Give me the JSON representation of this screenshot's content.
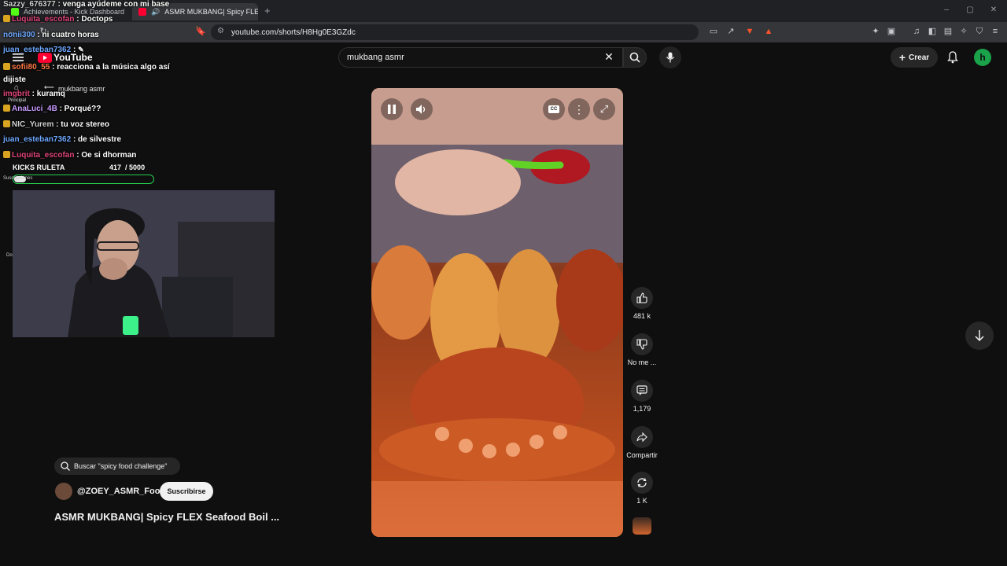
{
  "browser": {
    "tabs": [
      {
        "title": "Achievements - Kick Dashboard"
      },
      {
        "title": "ASMR MUKBANG| Spicy FLEX"
      }
    ],
    "url": "youtube.com/shorts/H8Hg0E3GZdc",
    "new_tab_icon": "plus-icon"
  },
  "youtube": {
    "logo_text": "YouTube",
    "search_query": "mukbang asmr",
    "create_label": "Crear",
    "avatar_letter": "h"
  },
  "chat": [
    {
      "user": "Sazzy_676377",
      "message": ": venga ayúdeme con mi base"
    },
    {
      "user": "Luquita_escofan",
      "message": ": Doctops"
    },
    {
      "user": "nonii300",
      "message": ": ni cuatro horas"
    },
    {
      "user": "juan_esteban7362",
      "message": ":"
    },
    {
      "user": "sofii80_55",
      "message": ": reacciona a la música algo así dijiste"
    },
    {
      "user": "imgbrit",
      "message": ": kuramq"
    },
    {
      "user": "AnaLuci_4B",
      "message": ": Porqué??"
    },
    {
      "user": "NIC_Yurem",
      "message": ": tu voz stereo"
    },
    {
      "user": "juan_esteban7362",
      "message": ": de silvestre"
    },
    {
      "user": "Luquita_escofan",
      "message": ": Oe si dhorman"
    }
  ],
  "overlay": {
    "ghost_search": "mukbang asmr",
    "ghost_home": "Principal",
    "roulette_label": "KICKS RULETA",
    "roulette_count": "417",
    "roulette_goal": "/ 5000",
    "roulette_progress": 0.083,
    "subs_label": "Suscripciones",
    "side_label": "Do"
  },
  "actions": {
    "like_count": "481 k",
    "dislike_label": "No me ...",
    "comments_count": "1,179",
    "share_label": "Compartir",
    "remix_count": "1 K"
  },
  "meta": {
    "search_chip": "Buscar \"spicy food challenge\"",
    "channel": "@ZOEY_ASMR_Food",
    "subscribe_label": "Suscribirse",
    "title": "ASMR MUKBANG| Spicy FLEX Seafood Boil ..."
  },
  "colors": {
    "yt_red": "#ff0033",
    "kick_green": "#53fc18",
    "avatar_green": "#1aa34a"
  }
}
